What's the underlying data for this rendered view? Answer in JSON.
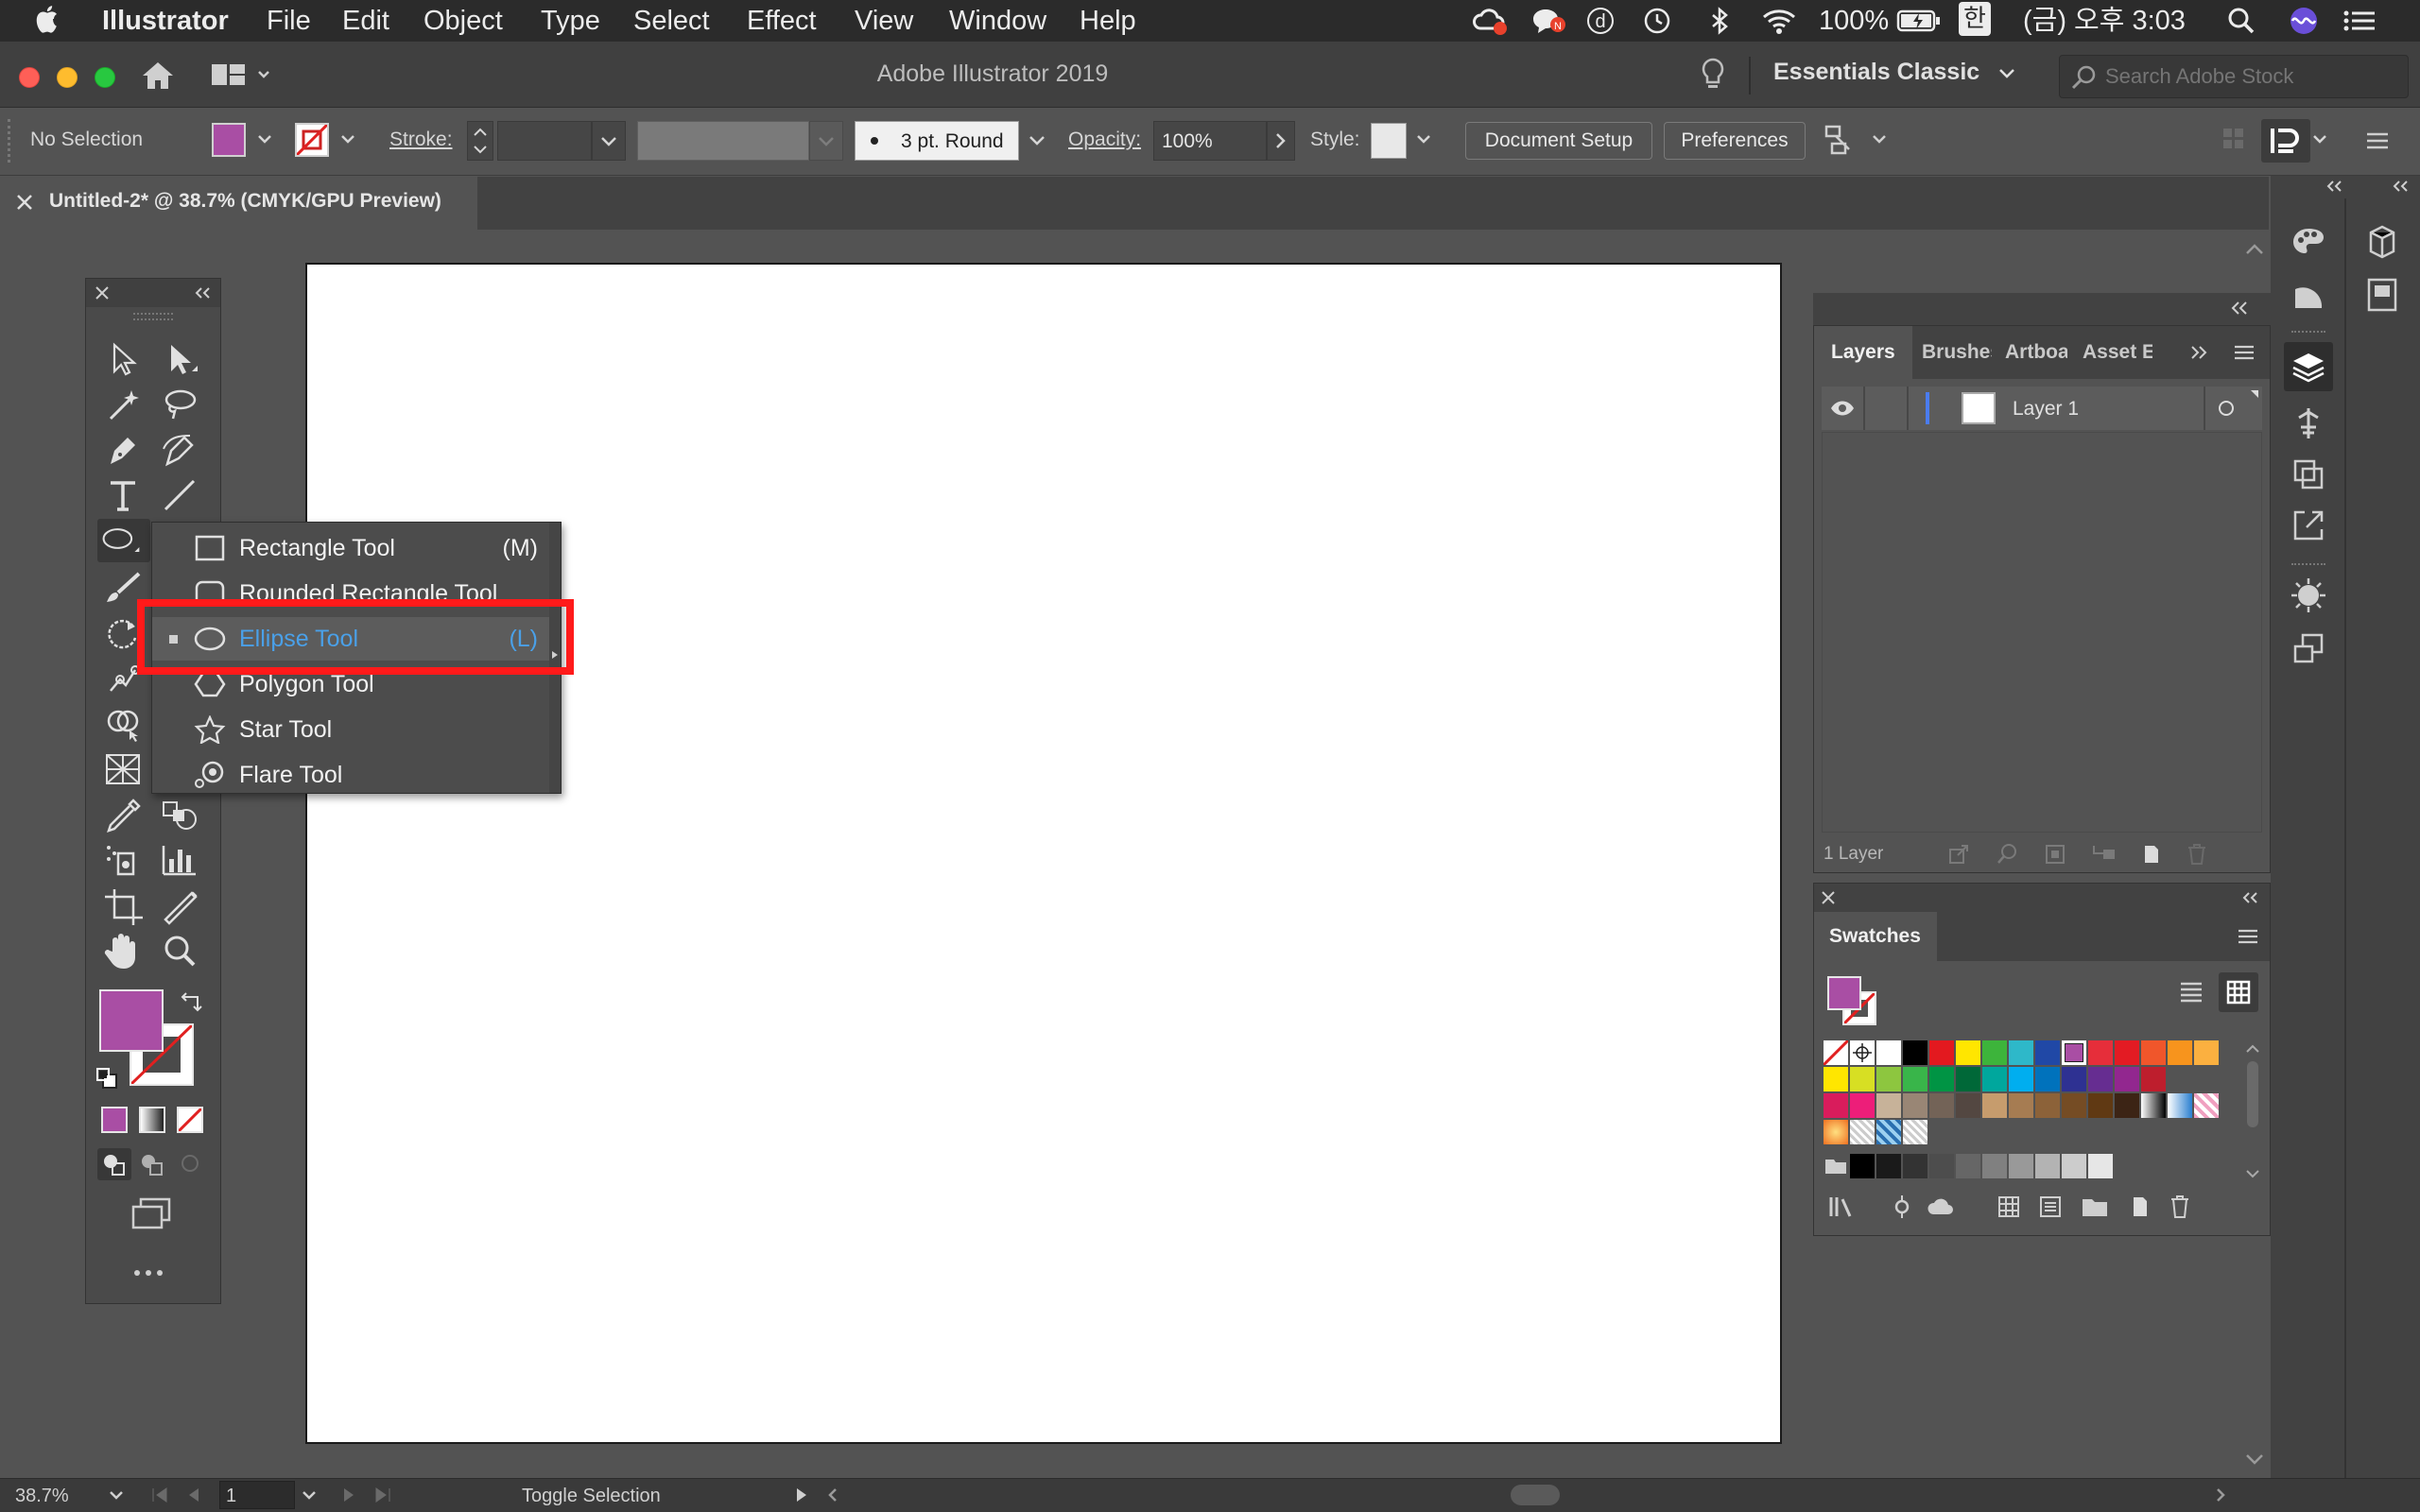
{
  "menubar": {
    "app_name": "Illustrator",
    "items": [
      "File",
      "Edit",
      "Object",
      "Type",
      "Select",
      "Effect",
      "View",
      "Window",
      "Help"
    ],
    "battery": "100%",
    "input_method": "한",
    "clock": "(금) 오후 3:03"
  },
  "window": {
    "title": "Adobe Illustrator 2019",
    "workspace": "Essentials Classic",
    "stock_search_placeholder": "Search Adobe Stock"
  },
  "control_bar": {
    "selection_status": "No Selection",
    "stroke_label": "Stroke:",
    "brush_profile": "3 pt. Round",
    "opacity_label": "Opacity:",
    "opacity_value": "100%",
    "style_label": "Style:",
    "document_setup": "Document Setup",
    "preferences": "Preferences"
  },
  "document": {
    "tab_title": "Untitled-2* @ 38.7% (CMYK/GPU Preview)"
  },
  "colors": {
    "fill": "#a94ea4",
    "accent_blue": "#4aa0e8",
    "highlight_red": "#ff1a1a"
  },
  "flyout": {
    "items": [
      {
        "label": "Rectangle Tool",
        "shortcut": "(M)"
      },
      {
        "label": "Rounded Rectangle Tool",
        "shortcut": ""
      },
      {
        "label": "Ellipse Tool",
        "shortcut": "(L)"
      },
      {
        "label": "Polygon Tool",
        "shortcut": ""
      },
      {
        "label": "Star Tool",
        "shortcut": ""
      },
      {
        "label": "Flare Tool",
        "shortcut": ""
      }
    ],
    "selected": "Ellipse Tool"
  },
  "layers_panel": {
    "tabs": [
      "Layers",
      "Brushes",
      "Artboards",
      "Asset Export"
    ],
    "layer_name": "Layer 1",
    "footer_count": "1 Layer"
  },
  "swatches_panel": {
    "title": "Swatches"
  },
  "status_bar": {
    "zoom": "38.7%",
    "artboard_number": "1",
    "status_text": "Toggle Selection"
  }
}
